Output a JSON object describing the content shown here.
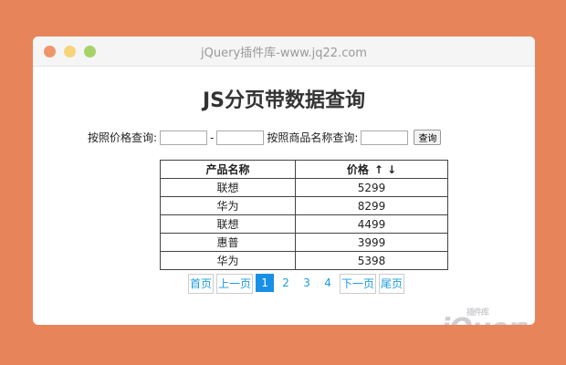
{
  "window": {
    "title": "jQuery插件库-www.jq22.com"
  },
  "page": {
    "heading": "JS分页带数据查询"
  },
  "search": {
    "price_label": "按照价格查询:",
    "separator": "-",
    "name_label": "按照商品名称查询:",
    "button_label": "查询"
  },
  "table": {
    "headers": [
      "产品名称",
      "价格"
    ],
    "sort_arrows": "↑ ↓",
    "rows": [
      [
        "联想",
        "5299"
      ],
      [
        "华为",
        "8299"
      ],
      [
        "联想",
        "4499"
      ],
      [
        "惠普",
        "3999"
      ],
      [
        "华为",
        "5398"
      ]
    ]
  },
  "pager": {
    "first": "首页",
    "prev": "上一页",
    "pages": [
      "1",
      "2",
      "3",
      "4"
    ],
    "next": "下一页",
    "last": "尾页"
  },
  "logo": {
    "text": "jQuery",
    "sub": "插件库"
  },
  "colors": {
    "accent": "#1890e6",
    "background": "#e8845a"
  }
}
